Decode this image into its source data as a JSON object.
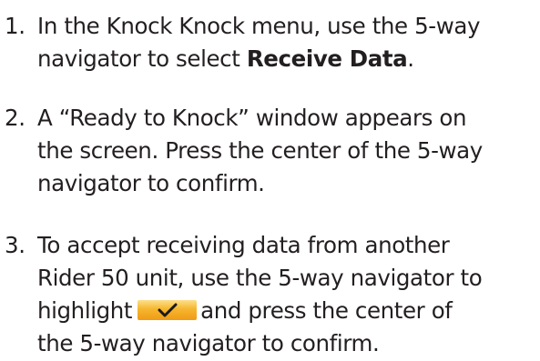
{
  "steps": [
    {
      "number": "1.",
      "lines": [
        [
          "In the Knock Knock menu, use the 5-way"
        ],
        [
          "navigator to select ",
          "Receive Data",
          "."
        ]
      ]
    },
    {
      "number": "2.",
      "lines": [
        [
          "A “Ready to Knock” window appears on"
        ],
        [
          "the screen. Press the center of the 5-way"
        ],
        [
          "navigator to confirm."
        ]
      ]
    },
    {
      "number": "3.",
      "lines": [
        [
          "To accept receiving data from another"
        ],
        [
          "Rider 50 unit, use the 5-way navigator to"
        ],
        [
          "highlight",
          "and press the center of"
        ],
        [
          "the 5-way navigator to confirm."
        ]
      ]
    }
  ],
  "icons": {
    "confirm": "checkmark-icon"
  },
  "colors": {
    "text": "#231f20",
    "check_button": "#f6b62f",
    "check_mark": "#1a1a1a"
  }
}
